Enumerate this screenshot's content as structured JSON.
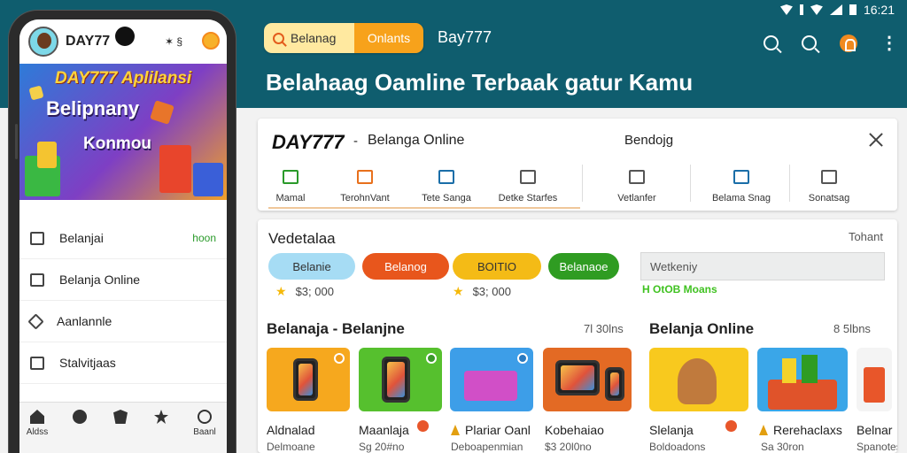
{
  "status_bar": {
    "time": "16:21"
  },
  "header": {
    "segment_left": "Belanag",
    "segment_right": "Onlants",
    "brand": "Bay777",
    "tagline": "Belahaag Oamline Terbaak gatur Kamu"
  },
  "card1": {
    "logo": "DAY777",
    "dash": "-",
    "title": "Belanga Online",
    "middle": "Bendojg",
    "tabs": [
      "Mamal",
      "TerohnVant",
      "Tete Sanga",
      "Detke Starfes",
      "Vetlanfer",
      "Belama Snag",
      "Sonatsag"
    ]
  },
  "card2": {
    "title": "Vedetalaa",
    "right_link": "Tohant",
    "pills": [
      {
        "label": "Belanie",
        "bg": "#a6dcf4",
        "fg": "#333333"
      },
      {
        "label": "Belanog",
        "bg": "#e8561c",
        "fg": "#ffffff"
      },
      {
        "label": "BOITIO",
        "bg": "#f4bb16",
        "fg": "#333333"
      },
      {
        "label": "Belanaoe",
        "bg": "#2f9c22",
        "fg": "#ffffff"
      }
    ],
    "prices": [
      "$3; 000",
      "$3; 000"
    ],
    "input_value": "Wetkeniy",
    "green_note": "H OtOB Moans",
    "section1_title": "Belanaja - Belanjne",
    "section1_more": "7l 30lns",
    "section2_title": "Belanja Online",
    "section2_more": "8 5lbns",
    "products": [
      {
        "name": "Aldnalad",
        "sub": "Delmoane"
      },
      {
        "name": "Maanlaja",
        "sub": "Sg 20#no"
      },
      {
        "name": "Plariar Oanl",
        "sub": "Deboapenmian"
      },
      {
        "name": "Kobehaiao",
        "sub": "$3 20l0no"
      },
      {
        "name": "Slelanja",
        "sub": "Boldoadons"
      },
      {
        "name": "Rerehaclaxs",
        "sub": "Sa 30ron"
      },
      {
        "name": "Belnar",
        "sub": "Spanotes"
      }
    ]
  },
  "phone": {
    "brand": "DAY77",
    "status": "✶ §",
    "banner_line1": "DAY777 Aplilansi",
    "banner_line2": "Belipnany",
    "banner_line3": "Konmou",
    "menu": [
      {
        "label": "Belanjai",
        "tag": "hoon"
      },
      {
        "label": "Belanja Online",
        "tag": ""
      },
      {
        "label": "Aanlannle",
        "tag": ""
      },
      {
        "label": "Stalvitjaas",
        "tag": ""
      }
    ],
    "nav": [
      "Aldss",
      "",
      "",
      "",
      "Baanl"
    ]
  }
}
